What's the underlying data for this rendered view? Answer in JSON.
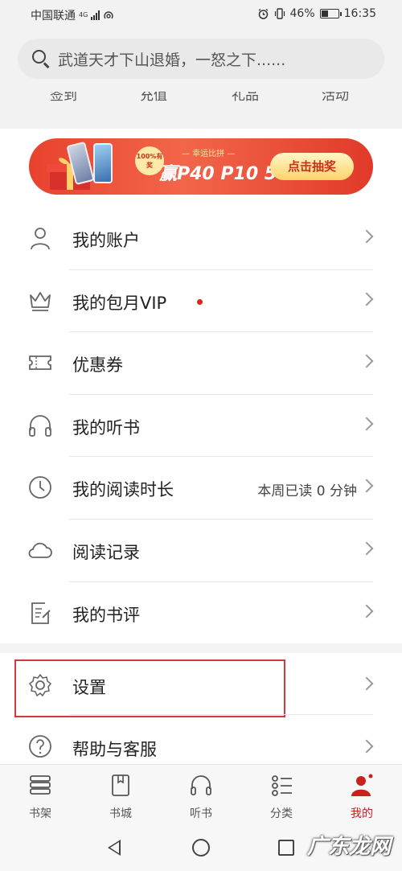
{
  "status_bar": {
    "carrier": "中国联通",
    "network": "4G",
    "battery": "46%",
    "battery_level": 0.46,
    "time": "16:35"
  },
  "search": {
    "placeholder": "武道天才下山退婚，一怒之下......"
  },
  "quick_row": [
    "签到",
    "充值",
    "礼品",
    "活动"
  ],
  "banner": {
    "badge": "100%有奖",
    "subtitle": "— 幸运比拼 —",
    "title": "赢P40 P10 5G",
    "button": "点击抽奖"
  },
  "menu": {
    "items": [
      {
        "label": "我的账户",
        "icon": "user-icon"
      },
      {
        "label": "我的包月VIP",
        "icon": "crown-icon",
        "has_dot": true
      },
      {
        "label": "优惠券",
        "icon": "coupon-icon"
      },
      {
        "label": "我的听书",
        "icon": "headphones-icon"
      },
      {
        "label": "我的阅读时长",
        "icon": "clock-icon",
        "extra": "本周已读 0 分钟"
      },
      {
        "label": "阅读记录",
        "icon": "cloud-icon"
      },
      {
        "label": "我的书评",
        "icon": "review-icon"
      }
    ],
    "settings": {
      "label": "设置",
      "icon": "gear-icon"
    },
    "help": {
      "label": "帮助与客服",
      "icon": "help-icon"
    }
  },
  "bottom_nav": {
    "items": [
      {
        "label": "书架",
        "icon": "bookshelf-icon"
      },
      {
        "label": "书城",
        "icon": "bookstore-icon"
      },
      {
        "label": "听书",
        "icon": "headphones-icon"
      },
      {
        "label": "分类",
        "icon": "category-icon"
      },
      {
        "label": "我的",
        "icon": "profile-icon",
        "active": true
      }
    ],
    "active_color": "#c8211e"
  },
  "watermark": "广东龙网",
  "colors": {
    "accent": "#d9261c",
    "banner": "#e8422e"
  }
}
